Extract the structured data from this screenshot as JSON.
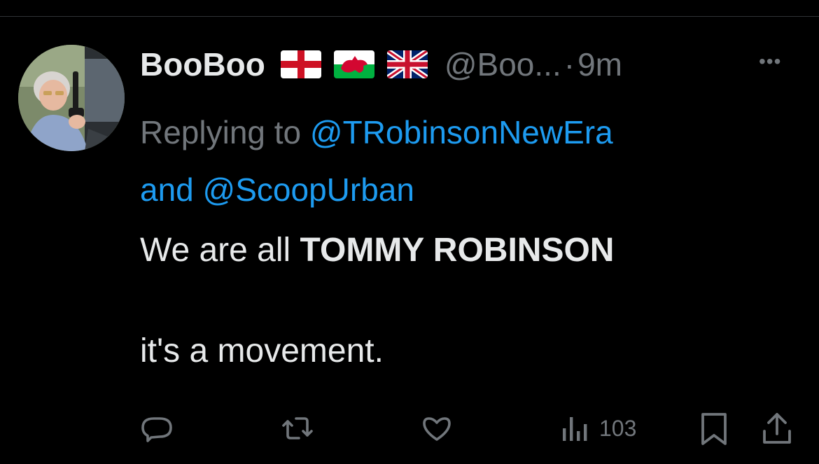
{
  "tweet": {
    "author": {
      "display_name": "BooBoo",
      "flags": [
        "england-flag",
        "wales-flag",
        "union-jack-flag"
      ],
      "handle": "@Boo...",
      "separator": "·",
      "time": "9m"
    },
    "more_label": "•••",
    "reply": {
      "prefix": "Replying to ",
      "mention_1": "@TRobinsonNewEra",
      "joiner": "and ",
      "mention_2": "@ScoopUrban"
    },
    "text": {
      "line1_normal": "We are all ",
      "line1_bold": "TOMMY ROBINSON",
      "line2": "it's a movement."
    },
    "actions": {
      "reply_icon": "reply-icon",
      "retweet_icon": "retweet-icon",
      "like_icon": "heart-icon",
      "views_icon": "views-icon",
      "views_count": "103",
      "bookmark_icon": "bookmark-icon",
      "share_icon": "share-icon"
    }
  },
  "colors": {
    "background": "#000000",
    "text_primary": "#e7e9ea",
    "text_secondary": "#71767b",
    "accent": "#1d9bf0",
    "divider": "#2f3336"
  }
}
